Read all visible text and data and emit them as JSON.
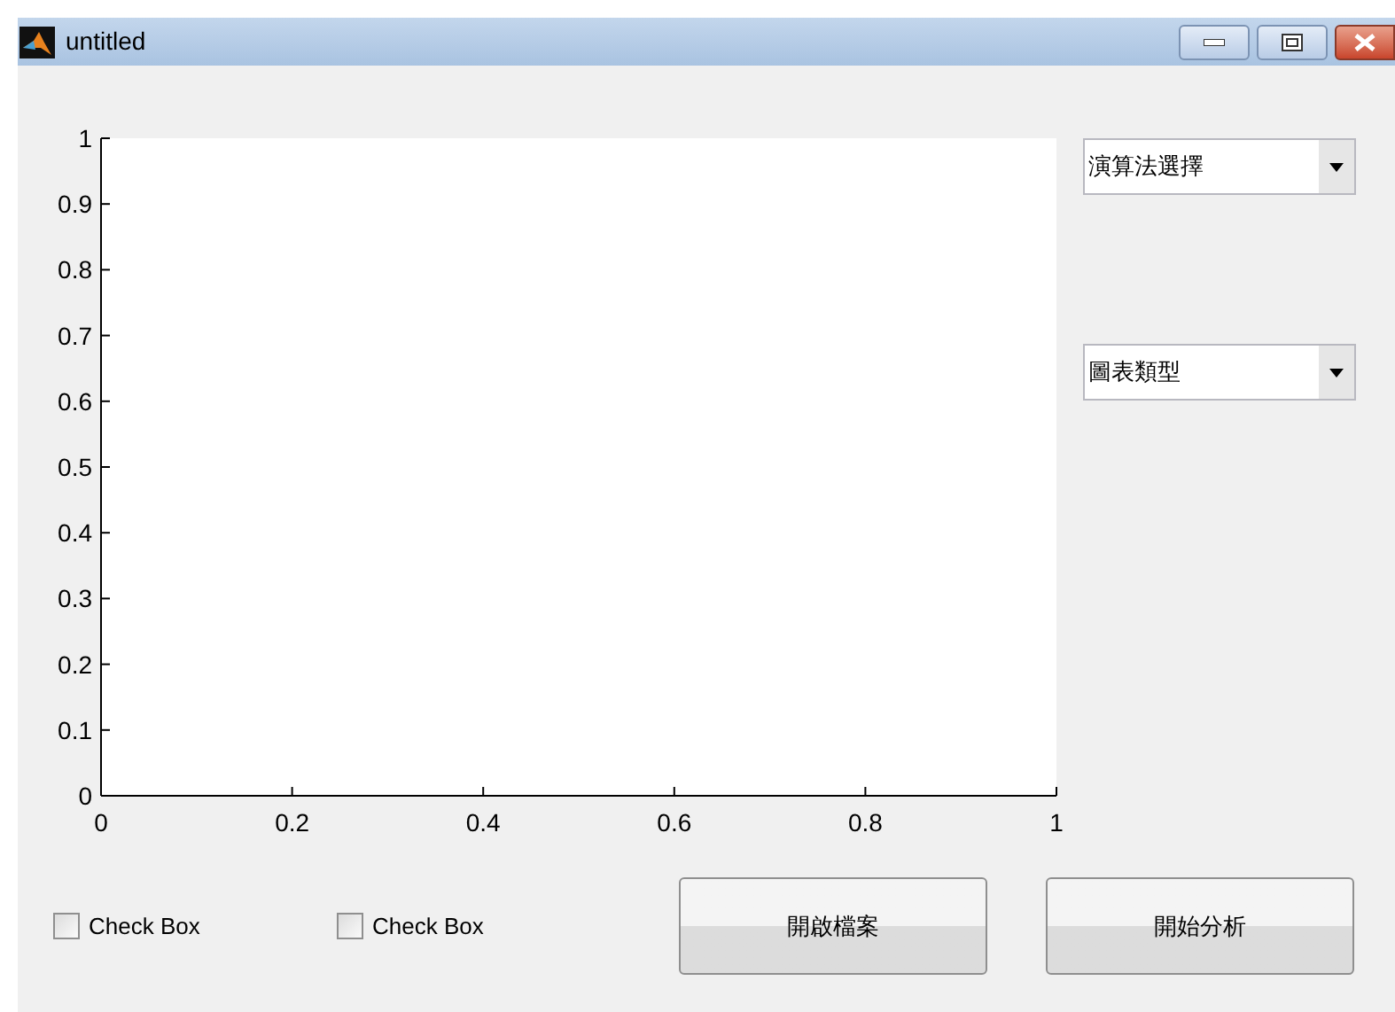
{
  "window": {
    "title": "untitled"
  },
  "chart_data": {
    "type": "line",
    "xlim": [
      0,
      1
    ],
    "ylim": [
      0,
      1
    ],
    "xticks": [
      0,
      0.2,
      0.4,
      0.6,
      0.8,
      1
    ],
    "yticks": [
      0,
      0.1,
      0.2,
      0.3,
      0.4,
      0.5,
      0.6,
      0.7,
      0.8,
      0.9,
      1
    ]
  },
  "dropdowns": [
    {
      "value": "演算法選擇"
    },
    {
      "value": "圖表類型"
    }
  ],
  "checkboxes": [
    {
      "label": "Check Box",
      "checked": false
    },
    {
      "label": "Check Box",
      "checked": false
    }
  ],
  "buttons": [
    "開啟檔案",
    "開始分析"
  ]
}
